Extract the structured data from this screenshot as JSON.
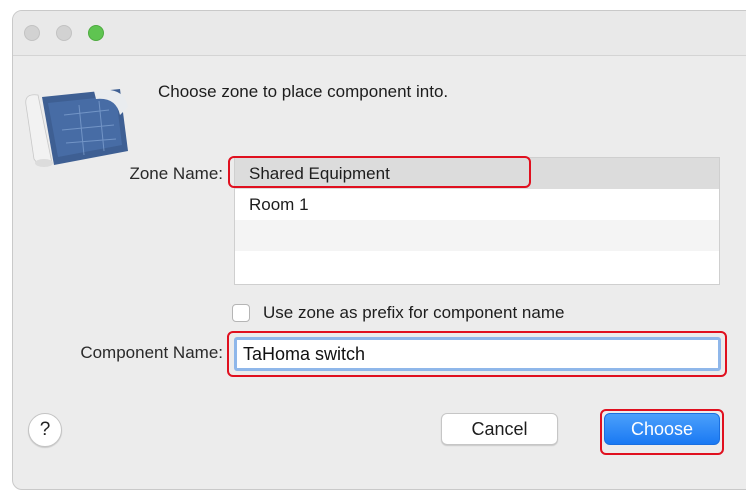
{
  "window": {
    "traffic_lights": [
      "close",
      "minimize",
      "zoom"
    ]
  },
  "icon": "blueprint-roll-icon",
  "dialog": {
    "prompt": "Choose zone to place component into."
  },
  "zone": {
    "label": "Zone Name:",
    "items": [
      "Shared Equipment",
      "Room 1"
    ],
    "selected": "Shared Equipment"
  },
  "prefix_option": {
    "label": "Use zone as prefix for component name",
    "checked": false
  },
  "component": {
    "label": "Component Name:",
    "value": "TaHoma switch"
  },
  "buttons": {
    "help": "?",
    "cancel": "Cancel",
    "choose": "Choose"
  },
  "colors": {
    "accent": "#1a79f3",
    "highlight": "#e0101f"
  }
}
